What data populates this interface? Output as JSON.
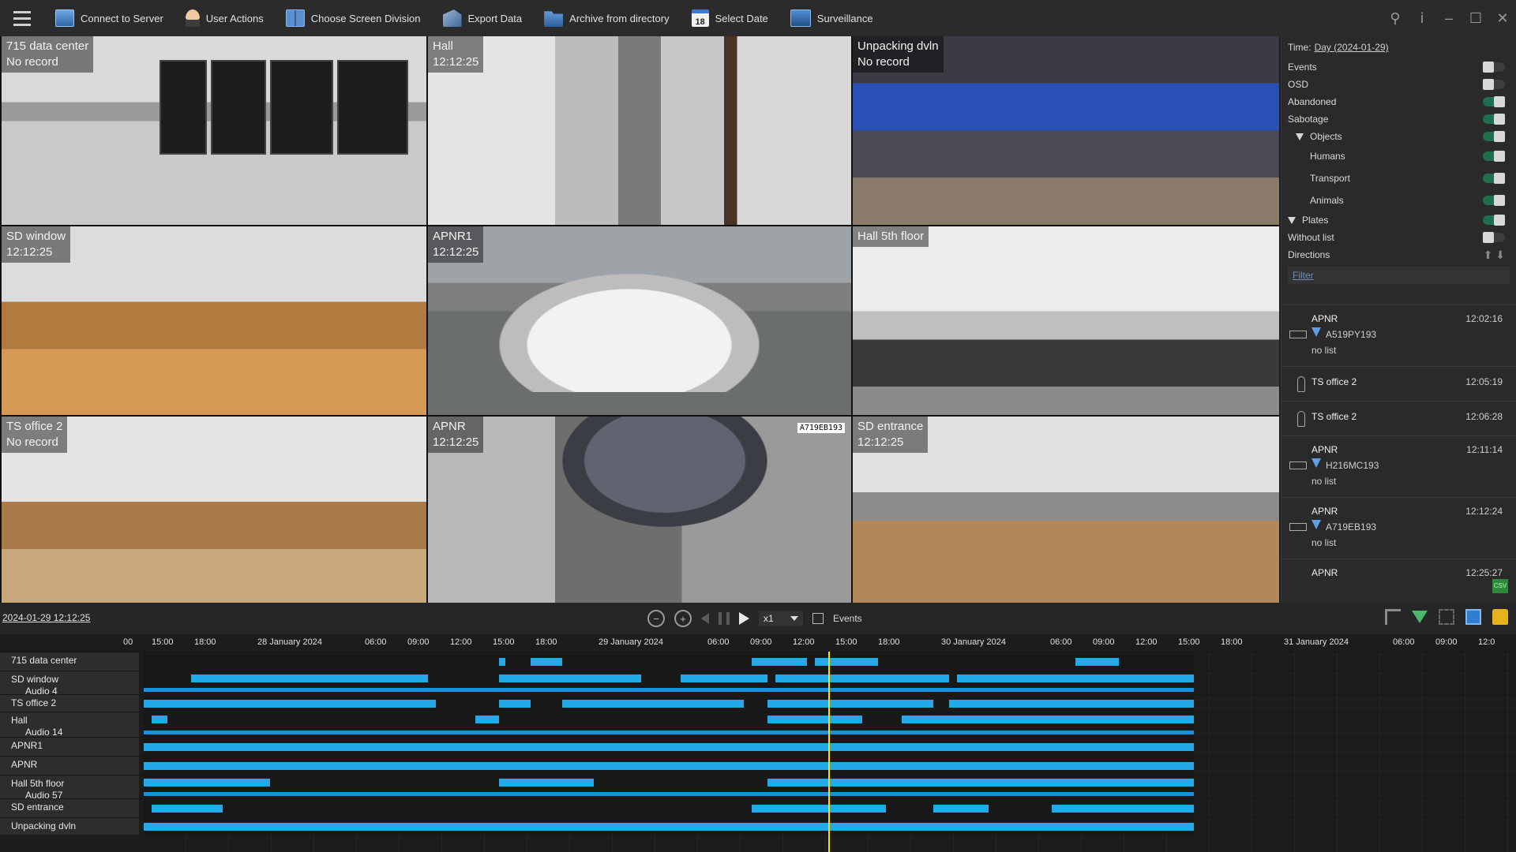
{
  "toolbar": {
    "items": [
      {
        "label": "Connect to Server",
        "icon": "server-icon"
      },
      {
        "label": "User Actions",
        "icon": "user-icon"
      },
      {
        "label": "Choose Screen Division",
        "icon": "screen-division-icon"
      },
      {
        "label": "Export Data",
        "icon": "export-icon"
      },
      {
        "label": "Archive from directory",
        "icon": "folder-icon"
      },
      {
        "label": "Select Date",
        "icon": "calendar-icon",
        "badge": "18"
      },
      {
        "label": "Surveillance",
        "icon": "monitor-icon"
      }
    ]
  },
  "cameras": [
    {
      "name": "715 data center",
      "status": "No record"
    },
    {
      "name": "Hall",
      "status": "12:12:25"
    },
    {
      "name": "Unpacking dvln",
      "status": "No record"
    },
    {
      "name": "SD window",
      "status": "12:12:25"
    },
    {
      "name": "APNR1",
      "status": "12:12:25"
    },
    {
      "name": "Hall 5th floor",
      "status": ""
    },
    {
      "name": "TS office 2",
      "status": "No record"
    },
    {
      "name": "APNR",
      "status": "12:12:25",
      "plate_overlay": "A719EB193"
    },
    {
      "name": "SD entrance",
      "status": "12:12:25"
    }
  ],
  "right_panel": {
    "time_label": "Time:",
    "time_value": "Day (2024-01-29)",
    "filters": [
      {
        "label": "Events",
        "on": false
      },
      {
        "label": "OSD",
        "on": false
      },
      {
        "label": "Abandoned",
        "on": true
      },
      {
        "label": "Sabotage",
        "on": true
      },
      {
        "label": "Objects",
        "on": true,
        "expanded": true
      },
      {
        "label": "Humans",
        "on": true,
        "child": true
      },
      {
        "label": "Transport",
        "on": true,
        "child": true
      },
      {
        "label": "Animals",
        "on": true,
        "child": true
      },
      {
        "label": "Plates",
        "on": true,
        "expanded": true
      },
      {
        "label": "Without list",
        "on": false
      },
      {
        "label": "Directions",
        "on": null
      }
    ],
    "filter_placeholder": "Filter",
    "events": [
      {
        "type": "apnr",
        "name": "APNR",
        "time": "12:02:16",
        "plate": "A519PY193",
        "list": "no list"
      },
      {
        "type": "person",
        "name": "TS office 2",
        "time": "12:05:19"
      },
      {
        "type": "person",
        "name": "TS office 2",
        "time": "12:06:28"
      },
      {
        "type": "apnr",
        "name": "APNR",
        "time": "12:11:14",
        "plate": "H216MC193",
        "list": "no list"
      },
      {
        "type": "apnr",
        "name": "APNR",
        "time": "12:12:24",
        "plate": "A719EB193",
        "list": "no list"
      },
      {
        "type": "apnr",
        "name": "APNR",
        "time": "12:25:27"
      }
    ],
    "csv_label": "CSV"
  },
  "playback": {
    "datetime": "2024-01-29 12:12:25",
    "speed": "x1",
    "events_label": "Events"
  },
  "timeline": {
    "scale": [
      "00",
      "15:00",
      "18:00",
      "28 January 2024",
      "06:00",
      "09:00",
      "12:00",
      "15:00",
      "18:00",
      "29 January 2024",
      "06:00",
      "09:00",
      "12:00",
      "15:00",
      "18:00",
      "30 January 2024",
      "06:00",
      "09:00",
      "12:00",
      "15:00",
      "18:00",
      "31 January 2024",
      "06:00",
      "09:00",
      "12:0"
    ],
    "rows": [
      {
        "name": "715 data center"
      },
      {
        "name": "SD window",
        "sub": "Audio 4"
      },
      {
        "name": "TS office 2"
      },
      {
        "name": "Hall",
        "sub": "Audio 14"
      },
      {
        "name": "APNR1"
      },
      {
        "name": "APNR"
      },
      {
        "name": "Hall 5th floor",
        "sub": "Audio 57"
      },
      {
        "name": "SD entrance"
      },
      {
        "name": "Unpacking dvln"
      }
    ]
  }
}
